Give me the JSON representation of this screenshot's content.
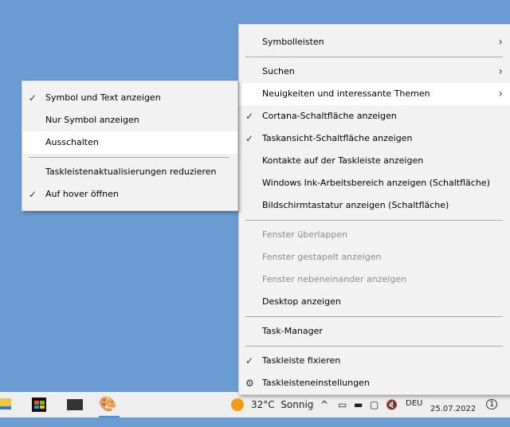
{
  "main_menu": [
    {
      "label": "Symbolleisten",
      "arrow": true
    },
    {
      "sep": true
    },
    {
      "label": "Suchen",
      "arrow": true
    },
    {
      "label": "Neuigkeiten und interessante Themen",
      "arrow": true,
      "hl": true
    },
    {
      "label": "Cortana-Schaltfläche anzeigen",
      "checked": true
    },
    {
      "label": "Taskansicht-Schaltfläche anzeigen",
      "checked": true
    },
    {
      "label": "Kontakte auf der Taskleiste anzeigen"
    },
    {
      "label": "Windows Ink-Arbeitsbereich anzeigen (Schaltfläche)"
    },
    {
      "label": "Bildschirmtastatur anzeigen (Schaltfläche)"
    },
    {
      "sep": true
    },
    {
      "label": "Fenster überlappen",
      "disabled": true
    },
    {
      "label": "Fenster gestapelt anzeigen",
      "disabled": true
    },
    {
      "label": "Fenster nebeneinander anzeigen",
      "disabled": true
    },
    {
      "label": "Desktop anzeigen"
    },
    {
      "sep": true
    },
    {
      "label": "Task-Manager"
    },
    {
      "sep": true
    },
    {
      "label": "Taskleiste fixieren",
      "checked": true
    },
    {
      "label": "Taskleisteneinstellungen",
      "gear": true
    }
  ],
  "sub_menu": [
    {
      "label": "Symbol und Text anzeigen",
      "checked": true
    },
    {
      "label": "Nur Symbol anzeigen"
    },
    {
      "label": "Ausschalten",
      "hl": true
    },
    {
      "sep": true
    },
    {
      "label": "Taskleistenaktualisierungen reduzieren"
    },
    {
      "label": "Auf hover öffnen",
      "checked": true
    }
  ],
  "taskbar": {
    "weather": "32°C  Sonnig",
    "lang": "DEU",
    "date": "25.07.2022",
    "notifications": "1"
  }
}
